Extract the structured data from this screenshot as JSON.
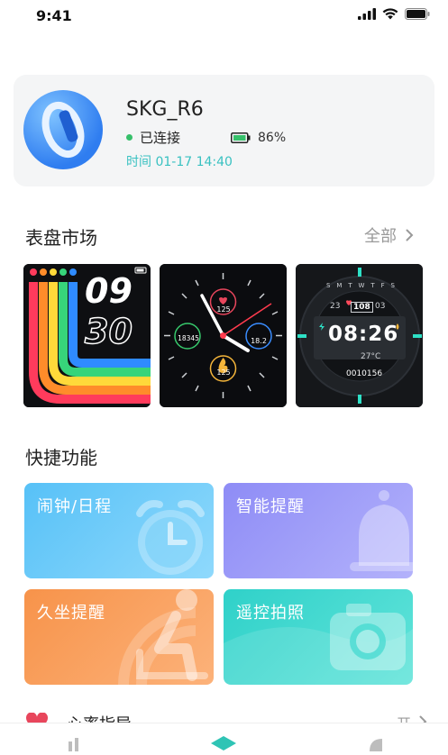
{
  "status_bar": {
    "time": "9:41"
  },
  "device": {
    "name": "SKG_R6",
    "status": "已连接",
    "battery": "86%",
    "sync_time": "时间 01-17 14:40"
  },
  "watch_market": {
    "title": "表盘市场",
    "see_all": "全部",
    "faces": [
      {
        "hour": "09",
        "minute": "30"
      },
      {
        "center_top": "125",
        "left": "18345",
        "right": "18.2",
        "bottom": "125"
      },
      {
        "time": "08:26",
        "top_left": "23",
        "top_mid": "108",
        "top_right": "03",
        "temp": "27°C",
        "steps": "0010156",
        "days": [
          "S",
          "M",
          "T",
          "W",
          "T",
          "F",
          "S"
        ]
      }
    ]
  },
  "quick_functions": {
    "title": "快捷功能",
    "tiles": [
      {
        "label": "闹钟/日程",
        "color_from": "#57c1f7",
        "color_to": "#7fd2fb"
      },
      {
        "label": "智能提醒",
        "color_from": "#8e8cf6",
        "color_to": "#a6a7fb"
      },
      {
        "label": "久坐提醒",
        "color_from": "#f7934a",
        "color_to": "#fbab6f"
      },
      {
        "label": "遥控拍照",
        "color_from": "#2fd1c9",
        "color_to": "#4be0d6"
      }
    ]
  },
  "bottom_item": {
    "label": "心率指导",
    "right": "开"
  }
}
